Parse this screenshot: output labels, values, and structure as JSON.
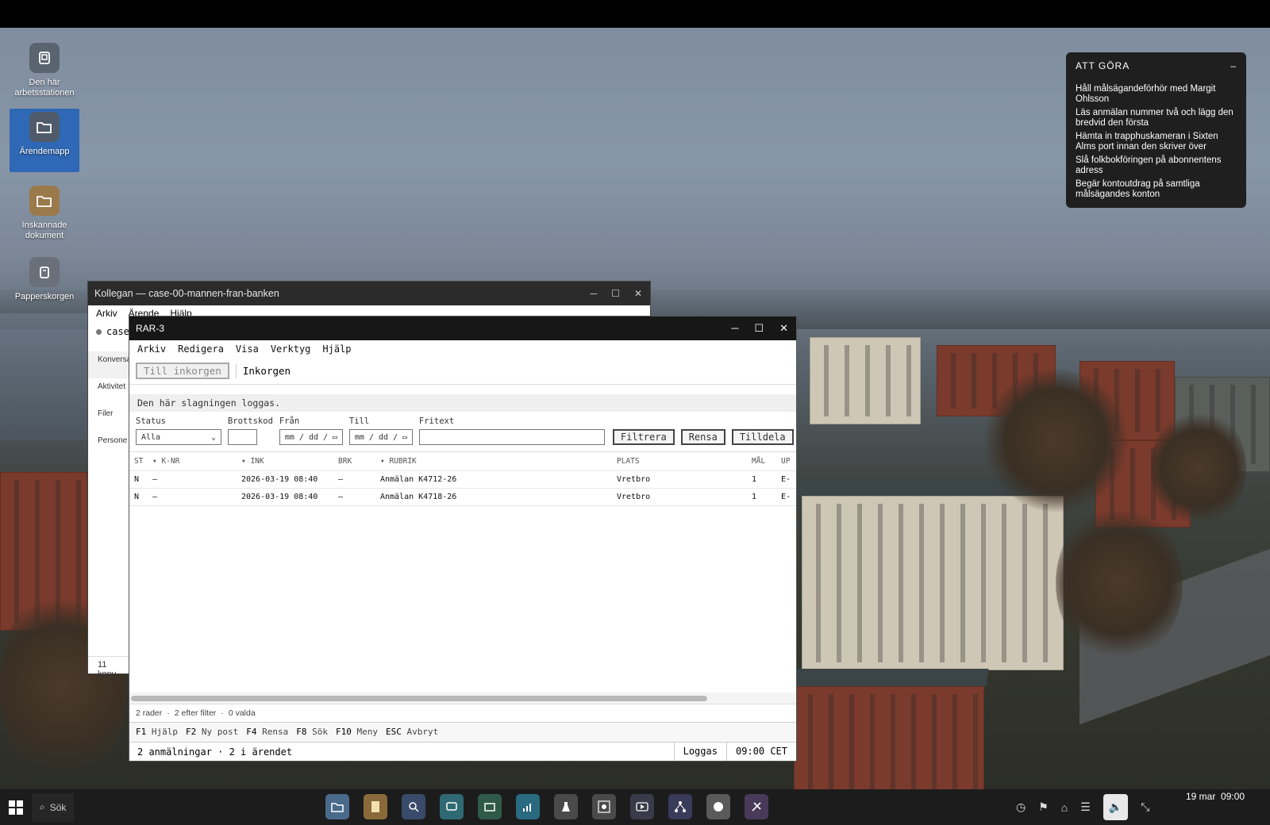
{
  "desktop": {
    "icons": [
      {
        "label": "Den här arbetsstationen",
        "icon": "computer-icon"
      },
      {
        "label": "Ärendemapp",
        "icon": "folder-open-icon"
      },
      {
        "label": "Inskannade dokument",
        "icon": "folder-icon"
      },
      {
        "label": "Papperskorgen",
        "icon": "trash-icon"
      }
    ]
  },
  "todo": {
    "title": "ATT GÖRA",
    "collapse": "–",
    "items": [
      "Håll målsägandeförhör med Margit Ohlsson",
      "Läs anmälan nummer två och lägg den bredvid den första",
      "Hämta in trapphuskameran i Sixten Alms port innan den skriver över",
      "Slå folkbokföringen på abonnentens adress",
      "Begär kontoutdrag på samtliga målsägandes konton"
    ]
  },
  "back_window": {
    "title": "Kollegan — case-00-mannen-fran-banken",
    "menu": [
      "Arkiv",
      "Ärende",
      "Hjälp"
    ],
    "case_label": "case",
    "side": [
      "Konversa",
      "Aktivitet",
      "Filer",
      "Persone"
    ],
    "footer": "11 konv"
  },
  "window": {
    "title": "RAR-3",
    "menu": [
      "Arkiv",
      "Redigera",
      "Visa",
      "Verktyg",
      "Hjälp"
    ],
    "toolbar": {
      "back_button": "Till inkorgen",
      "location": "Inkorgen"
    },
    "notice": "Den här slagningen loggas.",
    "filters": {
      "status_label": "Status",
      "status_value": "Alla",
      "brottskod_label": "Brottskod",
      "brottskod_value": "",
      "fran_label": "Från",
      "till_label": "Till",
      "date_placeholder": "mm / dd /",
      "fritext_label": "Fritext",
      "fritext_value": "",
      "filter_button": "Filtrera",
      "clear_button": "Rensa",
      "assign_button": "Tilldela"
    },
    "table": {
      "headers": [
        "ST",
        "▾ K-NR",
        "▾ INK",
        "BRK",
        "▾ RUBRIK",
        "PLATS",
        "MÅL",
        "UP"
      ],
      "rows": [
        [
          "N",
          "—",
          "2026-03-19 08:40",
          "—",
          "Anmälan K4712-26",
          "Vretbro",
          "1",
          "E-"
        ],
        [
          "N",
          "—",
          "2026-03-19 08:40",
          "—",
          "Anmälan K4718-26",
          "Vretbro",
          "1",
          "E-"
        ]
      ]
    },
    "status": {
      "rows": "2 rader",
      "filtered": "2 efter filter",
      "selected": "0 valda",
      "sep": "·"
    },
    "fkeys": [
      {
        "key": "F1",
        "label": "Hjälp"
      },
      {
        "key": "F2",
        "label": "Ny post"
      },
      {
        "key": "F4",
        "label": "Rensa"
      },
      {
        "key": "F8",
        "label": "Sök"
      },
      {
        "key": "F10",
        "label": "Meny"
      },
      {
        "key": "ESC",
        "label": "Avbryt"
      }
    ],
    "statusbar": {
      "summary": "2 anmälningar · 2 i ärendet",
      "log": "Loggas",
      "time": "09:00 CET"
    }
  },
  "taskbar": {
    "search": "Sök",
    "clock_date": "19 mar",
    "clock_time": "09:00",
    "apps": [
      {
        "icon": "folder-icon",
        "color": "#4a6a8c"
      },
      {
        "icon": "document-icon",
        "color": "#8a6a3a"
      },
      {
        "icon": "search-doc-icon",
        "color": "#3a4a6a"
      },
      {
        "icon": "chat-icon",
        "color": "#2f6a74"
      },
      {
        "icon": "mail-icon",
        "color": "#2f5a4a"
      },
      {
        "icon": "signal-icon",
        "color": "#2a6a80"
      },
      {
        "icon": "flask-icon",
        "color": "#4a4a4a"
      },
      {
        "icon": "scan-icon",
        "color": "#4a4a4a"
      },
      {
        "icon": "video-icon",
        "color": "#3a3a4a"
      },
      {
        "icon": "network-icon",
        "color": "#3a3a5a"
      },
      {
        "icon": "disc-icon",
        "color": "#5a5a5a"
      },
      {
        "icon": "tools-icon",
        "color": "#4a3a5a"
      }
    ]
  }
}
